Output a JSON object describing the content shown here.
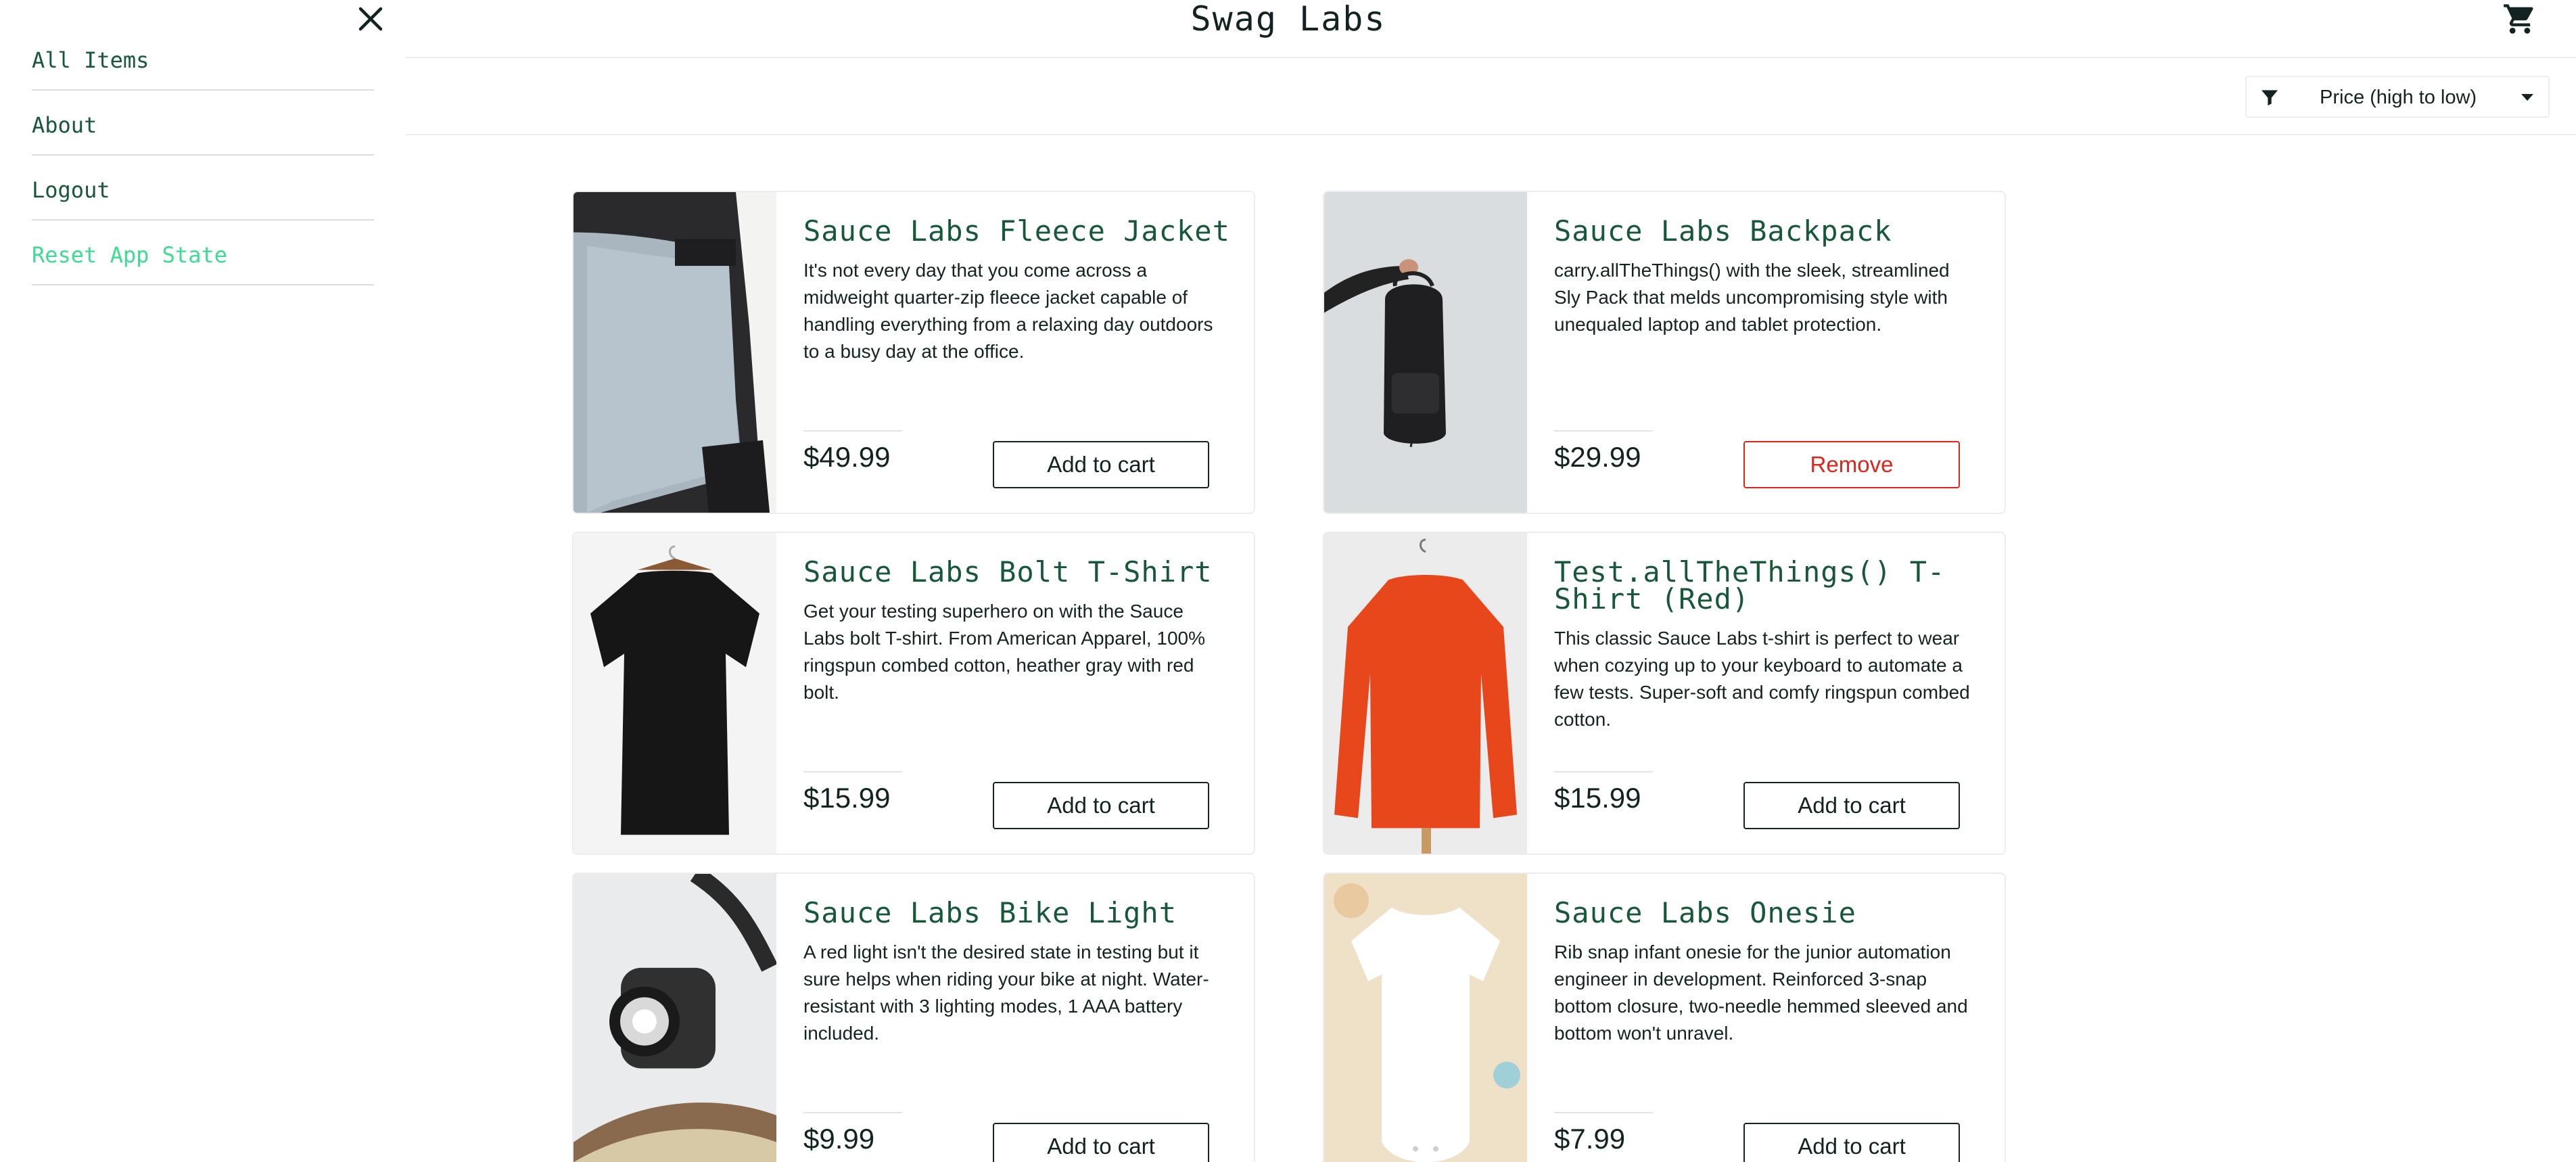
{
  "header": {
    "title": "Swag Labs",
    "cart_icon": "cart-icon"
  },
  "sort": {
    "selected": "Price (high to low)",
    "icon": "filter-icon"
  },
  "menu": {
    "close_icon": "close-icon",
    "items": [
      {
        "label": "All Items"
      },
      {
        "label": "About"
      },
      {
        "label": "Logout"
      },
      {
        "label": "Reset App State"
      }
    ],
    "accent_color": "#3ddc91"
  },
  "inventory": [
    {
      "name": "Sauce Labs Fleece Jacket",
      "description": "It's not every day that you come across a midweight quarter-zip fleece jacket capable of handling everything from a relaxing day outdoors to a busy day at the office.",
      "price": "$49.99",
      "button": "Add to cart"
    },
    {
      "name": "Sauce Labs Backpack",
      "description": "carry.allTheThings() with the sleek, streamlined Sly Pack that melds uncompromising style with unequaled laptop and tablet protection.",
      "price": "$29.99",
      "button": "Remove"
    },
    {
      "name": "Sauce Labs Bolt T-Shirt",
      "description": "Get your testing superhero on with the Sauce Labs bolt T-shirt. From American Apparel, 100% ringspun combed cotton, heather gray with red bolt.",
      "price": "$15.99",
      "button": "Add to cart"
    },
    {
      "name": "Test.allTheThings() T-Shirt (Red)",
      "description": "This classic Sauce Labs t-shirt is perfect to wear when cozying up to your keyboard to automate a few tests. Super-soft and comfy ringspun combed cotton.",
      "price": "$15.99",
      "button": "Add to cart"
    },
    {
      "name": "Sauce Labs Bike Light",
      "description": "A red light isn't the desired state in testing but it sure helps when riding your bike at night. Water-resistant with 3 lighting modes, 1 AAA battery included.",
      "price": "$9.99",
      "button": "Add to cart"
    },
    {
      "name": "Sauce Labs Onesie",
      "description": "Rib snap infant onesie for the junior automation engineer in development. Reinforced 3-snap bottom closure, two-needle hemmed sleeved and bottom won't unravel.",
      "price": "$7.99",
      "button": "Add to cart"
    }
  ]
}
